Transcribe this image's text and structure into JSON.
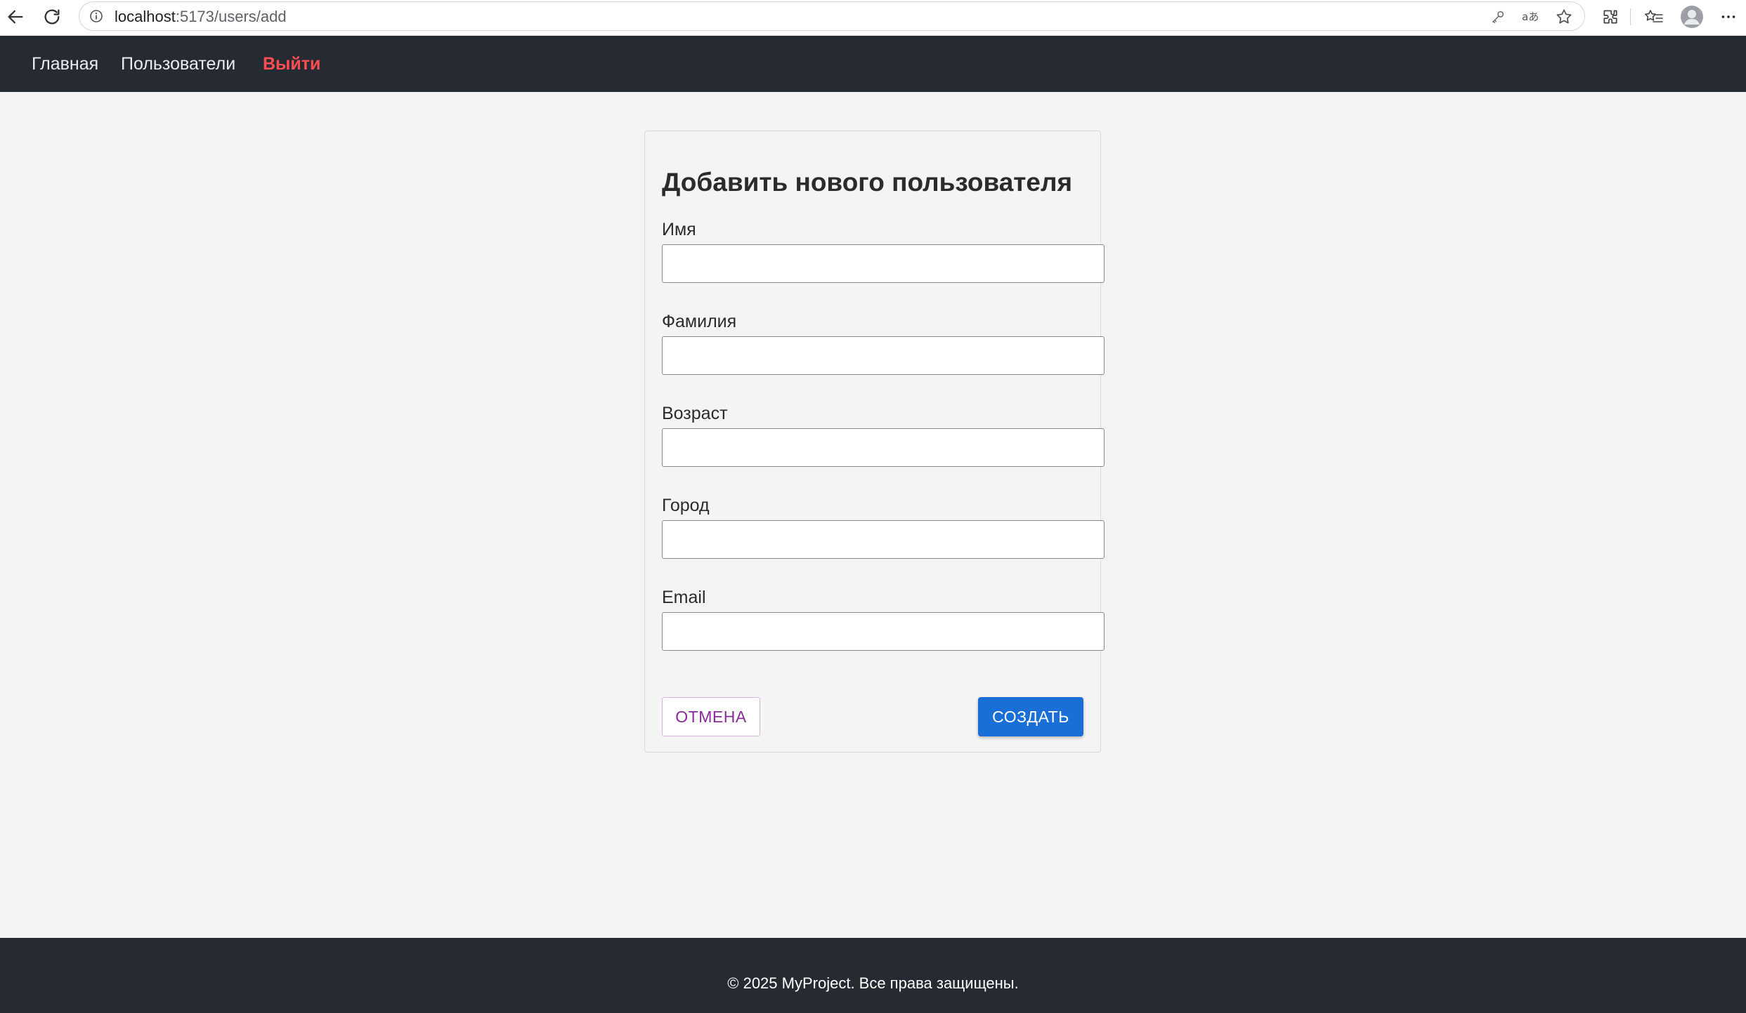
{
  "browser": {
    "url_host": "localhost",
    "url_rest": ":5173/users/add"
  },
  "nav": {
    "home": "Главная",
    "users": "Пользователи",
    "logout": "Выйти"
  },
  "form": {
    "title": "Добавить нового пользователя",
    "fields": [
      {
        "label": "Имя",
        "value": ""
      },
      {
        "label": "Фамилия",
        "value": ""
      },
      {
        "label": "Возраст",
        "value": ""
      },
      {
        "label": "Город",
        "value": ""
      },
      {
        "label": "Email",
        "value": ""
      }
    ],
    "cancel_label": "ОТМЕНА",
    "create_label": "СОЗДАТЬ"
  },
  "footer": {
    "text": "© 2025 MyProject. Все права защищены."
  },
  "colors": {
    "header_bg": "#252a33",
    "logout": "#ff4d4f",
    "primary": "#1a6fd6",
    "cancel_text": "#8b2a9a"
  }
}
